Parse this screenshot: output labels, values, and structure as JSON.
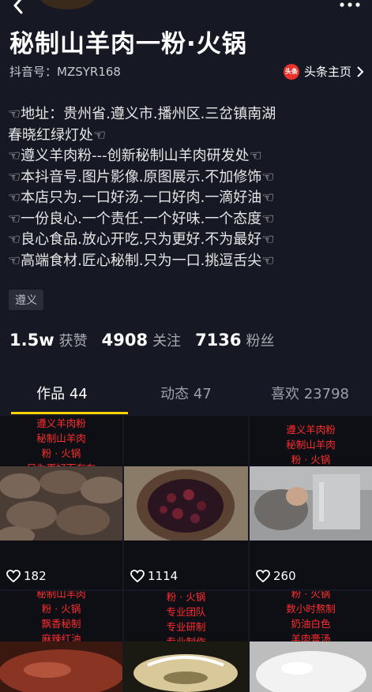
{
  "profile": {
    "title": "秘制山羊肉一粉·火锅",
    "id_label": "抖音号：",
    "id_value": "MZSYR168",
    "toutiao_logo": "头条",
    "toutiao_label": "头条主页"
  },
  "bio": [
    "☜地址：贵州省.遵义市.播州区.三岔镇南湖",
    "春晓红绿灯处☜",
    "☜遵义羊肉粉---创新秘制山羊肉研发处☜",
    "☜本抖音号.图片影像.原图展示.不加修饰☜",
    "☜本店只为.一口好汤.一口好肉.一滴好油☜",
    "☜一份良心.一个责任.一个好味.一个态度☜",
    "☜良心食品.放心开吃.只为更好.不为最好☜",
    "☜高端食材.匠心秘制.只为一口.挑逗舌尖☜"
  ],
  "tag": "遵义",
  "stats": [
    {
      "num": "1.5w",
      "label": "获赞"
    },
    {
      "num": "4908",
      "label": "关注"
    },
    {
      "num": "7136",
      "label": "粉丝"
    }
  ],
  "tabs": [
    {
      "label": "作品 44",
      "active": true
    },
    {
      "label": "动态 47",
      "active": false
    },
    {
      "label": "喜欢 23798",
      "active": false
    }
  ],
  "videos": [
    {
      "caption": [
        "遵义羊肉粉",
        "秘制山羊肉",
        "粉 · 火锅",
        "只为更好而存在"
      ],
      "likes": "182",
      "photo_color": "#6b5a4e"
    },
    {
      "caption": [],
      "likes": "1114",
      "photo_color": "#7a5a45"
    },
    {
      "caption": [
        "",
        "遵义羊肉粉",
        "秘制山羊肉",
        "粉 · 火锅"
      ],
      "likes": "260",
      "photo_color": "#8a8c90"
    },
    {
      "caption": [
        "秘制山羊肉",
        "粉 · 火锅",
        "飘香秘制",
        "麻辣红油"
      ],
      "likes": "",
      "photo_color": "#8a3a2a"
    },
    {
      "caption": [
        "粉 · 火锅",
        "专业团队",
        "专业研制",
        "专业制作"
      ],
      "likes": "",
      "photo_color": "#c9b890"
    },
    {
      "caption": [
        "粉 · 火锅",
        "数小时熬制",
        "奶油白色",
        "羊肉膏汤"
      ],
      "likes": "",
      "photo_color": "#e8e8e8"
    }
  ],
  "icons": {
    "back": "chevron-left-icon",
    "more": "more-dots-icon",
    "toutiao": "toutiao-logo",
    "heart": "heart-outline-icon"
  }
}
